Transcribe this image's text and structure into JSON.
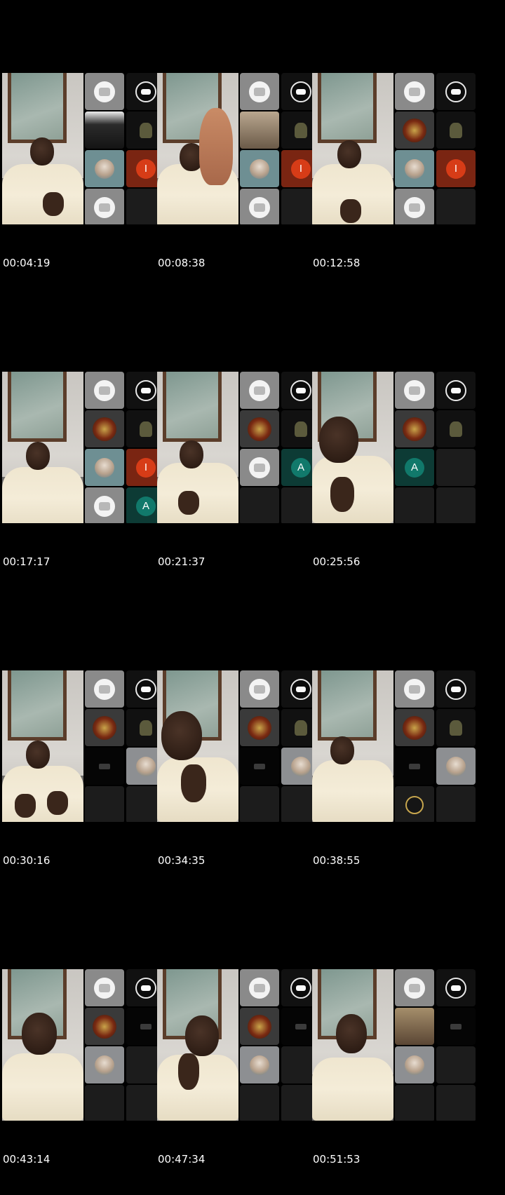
{
  "sheet": {
    "frames": [
      {
        "timestamp": "00:04:19"
      },
      {
        "timestamp": "00:08:38"
      },
      {
        "timestamp": "00:12:58"
      },
      {
        "timestamp": "00:17:17"
      },
      {
        "timestamp": "00:21:37"
      },
      {
        "timestamp": "00:25:56"
      },
      {
        "timestamp": "00:30:16"
      },
      {
        "timestamp": "00:34:35"
      },
      {
        "timestamp": "00:38:55"
      },
      {
        "timestamp": "00:43:14"
      },
      {
        "timestamp": "00:47:34"
      },
      {
        "timestamp": "00:51:53"
      }
    ]
  },
  "badges": {
    "i": "I",
    "a": "A"
  },
  "colors": {
    "background": "#000000",
    "badge_i": "#d73c17",
    "badge_a": "#11796b",
    "tile_grey": "#8a8a8a",
    "timestamp_text": "#ffffff"
  }
}
